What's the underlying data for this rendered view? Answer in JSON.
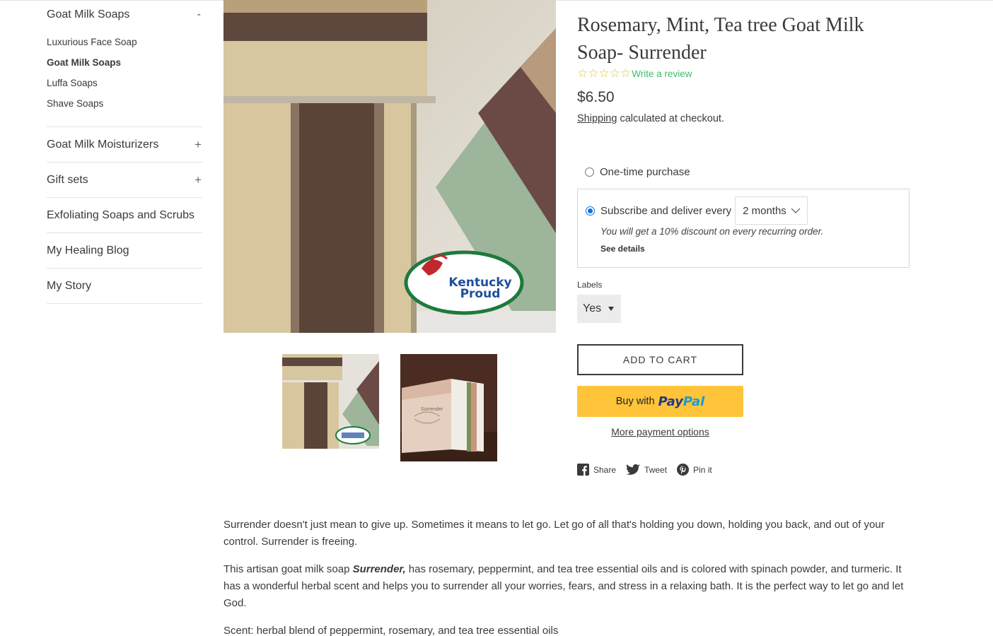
{
  "sidebar": {
    "open_section": {
      "label": "Goat Milk Soaps",
      "toggle": "-"
    },
    "sub_items": [
      {
        "label": "Luxurious Face Soap",
        "active": false
      },
      {
        "label": "Goat Milk Soaps",
        "active": true
      },
      {
        "label": "Luffa Soaps",
        "active": false
      },
      {
        "label": "Shave Soaps",
        "active": false
      }
    ],
    "sections": [
      {
        "label": "Goat Milk Moisturizers",
        "toggle": "+"
      },
      {
        "label": "Gift sets",
        "toggle": "+"
      },
      {
        "label": "Exfoliating Soaps and Scrubs",
        "toggle": ""
      },
      {
        "label": "My Healing Blog",
        "toggle": ""
      },
      {
        "label": "My Story",
        "toggle": ""
      }
    ]
  },
  "gallery": {
    "logo_line1": "Kentucky",
    "logo_line2": "Proud",
    "thumb2_text": "Surrender"
  },
  "product": {
    "title": "Rosemary, Mint, Tea tree Goat Milk Soap- Surrender",
    "stars": "☆☆☆☆☆",
    "review_link": "Write a review",
    "price": "$6.50",
    "shipping_link": "Shipping",
    "shipping_rest": " calculated at checkout.",
    "one_time": "One-time purchase",
    "subscribe": "Subscribe and deliver every",
    "frequency": "2 months",
    "discount": "You will get a 10% discount on every recurring order.",
    "see_details": "See details",
    "labels_label": "Labels",
    "labels_value": "Yes",
    "add_to_cart": "ADD TO CART",
    "paypal_buy": "Buy with",
    "paypal_pay": "Pay",
    "paypal_pal": "Pal",
    "more_payment": "More payment options",
    "share": "Share",
    "tweet": "Tweet",
    "pin": "Pin it"
  },
  "description": {
    "p1": "Surrender doesn't just mean to give up.  Sometimes it means to let go. Let go of all that's holding you down, holding you back, and out of your control. Surrender is freeing.",
    "p2_before": "This artisan goat milk soap ",
    "p2_bold": "Surrender,",
    "p2_after": " has rosemary, peppermint, and tea tree essential oils and is colored with spinach powder, and turmeric. It has a wonderful herbal scent and helps you to surrender all your worries, fears, and stress in a relaxing bath. It is the perfect way to let go and let God.",
    "p3": "Scent: herbal blend of peppermint, rosemary, and tea tree essential oils"
  },
  "colors": {
    "accent_green": "#3dbd6a",
    "star_yellow": "#e8c32d",
    "paypal_yellow": "#ffc439",
    "radio_blue": "#0f6fde"
  }
}
